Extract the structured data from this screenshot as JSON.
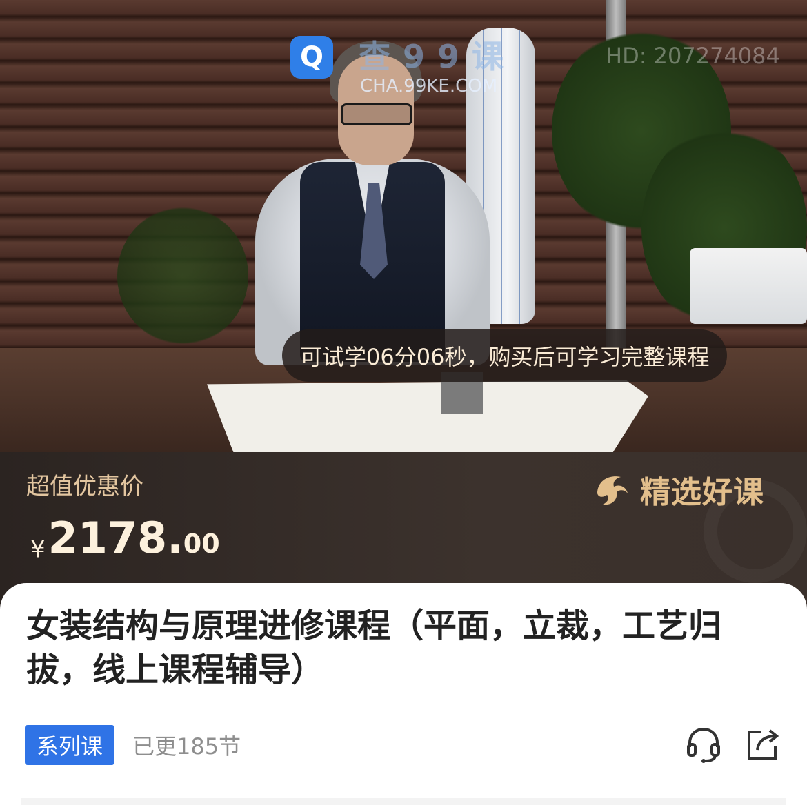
{
  "video": {
    "watermark_logo": "Q",
    "watermark_title": "查99课",
    "watermark_url": "CHA.99KE.COM",
    "watermark_id": "HD: 207274084",
    "trial_notice": "可试学06分06秒，购买后可学习完整课程"
  },
  "price_banner": {
    "label": "超值优惠价",
    "currency": "¥",
    "price_integer": "2178.",
    "price_decimal": "00",
    "badge_icon": "dolphin-icon",
    "badge_text": "精选好课"
  },
  "course": {
    "title": "女装结构与原理进修课程（平面，立裁，工艺归拔，线上课程辅导）",
    "type_tag": "系列课",
    "updated_text": "已更185节",
    "customer_service_icon": "headset-icon",
    "share_icon": "share-icon"
  },
  "colors": {
    "accent_blue": "#2f73e6",
    "banner_bg": "#2b2421",
    "gold": "#e3bf8c"
  }
}
